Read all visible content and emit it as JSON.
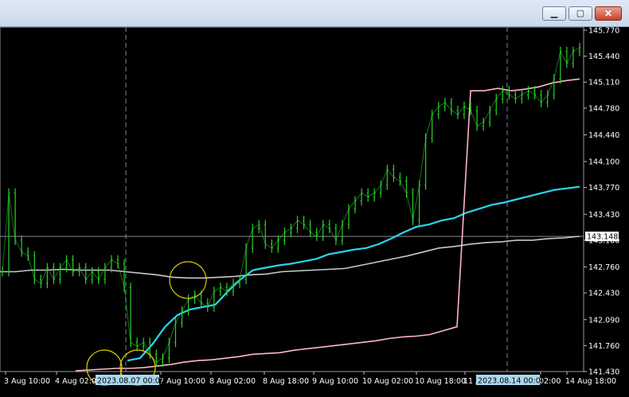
{
  "window": {
    "minimize_glyph": "▁",
    "maximize_glyph": "▢",
    "close_glyph": "✕"
  },
  "colors": {
    "background": "#000000",
    "candle": "#2bd12b",
    "ma_fast": "#2ad7f0",
    "ma_mid": "#c9c9c9",
    "ma_slow": "#ffb6c8",
    "price_line": "#8c8c8c",
    "crosshair": "#6c8fb0",
    "circle": "#d8cc00",
    "tag_bg": "#a9d8f0"
  },
  "chart_data": {
    "type": "line",
    "y_range": [
      141.43,
      145.77
    ],
    "y_ticks": [
      "145.770",
      "145.440",
      "145.110",
      "144.780",
      "144.440",
      "144.100",
      "143.770",
      "143.430",
      "143.100",
      "142.760",
      "142.430",
      "142.090",
      "141.760",
      "141.430"
    ],
    "current_price": "143.148",
    "x_labels": [
      "3 Aug 10:00",
      "4 Aug 02:00",
      "7 Aug 10:00",
      "8 Aug 02:00",
      "8 Aug 18:00",
      "9 Aug 10:00",
      "10 Aug 02:00",
      "10 Aug 18:00",
      "11 Aug",
      "02:00",
      "14 Aug 18:00"
    ],
    "crosshair_labels": [
      "2023.08.07 00:00",
      "2023.08.14 00:00"
    ],
    "price": [
      142.7,
      143.7,
      143.1,
      142.95,
      142.9,
      142.6,
      142.55,
      142.75,
      142.6,
      142.75,
      142.85,
      142.7,
      142.75,
      142.6,
      142.7,
      142.6,
      142.75,
      142.85,
      142.8,
      142.5,
      141.8,
      141.75,
      141.8,
      141.65,
      141.55,
      141.6,
      141.8,
      142.05,
      142.2,
      142.35,
      142.4,
      142.3,
      142.25,
      142.45,
      142.5,
      142.45,
      142.55,
      142.6,
      143.0,
      143.25,
      143.3,
      143.05,
      143.0,
      143.1,
      143.2,
      143.25,
      143.35,
      143.3,
      143.2,
      143.15,
      143.3,
      143.25,
      143.1,
      143.3,
      143.5,
      143.6,
      143.7,
      143.65,
      143.7,
      143.8,
      144.0,
      143.9,
      143.85,
      143.7,
      143.35,
      143.8,
      144.4,
      144.7,
      144.8,
      144.85,
      144.75,
      144.7,
      144.8,
      144.75,
      144.55,
      144.6,
      144.75,
      144.9,
      145.0,
      144.95,
      144.9,
      144.95,
      145.0,
      144.95,
      144.85,
      144.95,
      145.15,
      145.5,
      145.35,
      145.5,
      145.55
    ],
    "series": [
      {
        "values": [
          142.7,
          142.7,
          142.72,
          142.72,
          142.73,
          142.72,
          142.72,
          142.72,
          142.7,
          142.68,
          142.66,
          142.63,
          142.62,
          142.62,
          142.63,
          142.64,
          142.66,
          142.67,
          142.7,
          142.71,
          142.72,
          142.73,
          142.74,
          142.78,
          142.82,
          142.86,
          142.9,
          142.95,
          143.0,
          143.02,
          143.05,
          143.07,
          143.08,
          143.1,
          143.1,
          143.12,
          143.13,
          143.15
        ]
      },
      {
        "values": [
          141.57,
          141.6,
          141.78,
          142.0,
          142.15,
          142.22,
          142.25,
          142.28,
          142.45,
          142.6,
          142.72,
          142.75,
          142.78,
          142.8,
          142.83,
          142.86,
          142.92,
          142.95,
          142.98,
          143.0,
          143.05,
          143.12,
          143.2,
          143.27,
          143.3,
          143.35,
          143.38,
          143.45,
          143.5,
          143.55,
          143.58,
          143.62,
          143.66,
          143.7,
          143.74,
          143.76,
          143.78
        ]
      },
      {
        "values": [
          141.44,
          141.45,
          141.46,
          141.47,
          141.47,
          141.48,
          141.5,
          141.52,
          141.55,
          141.57,
          141.58,
          141.6,
          141.62,
          141.65,
          141.66,
          141.67,
          141.7,
          141.72,
          141.74,
          141.76,
          141.78,
          141.8,
          141.82,
          141.85,
          141.87,
          141.88,
          141.9,
          141.95,
          142.0,
          145.0,
          145.0,
          145.03,
          145.0,
          145.02,
          145.05,
          145.1,
          145.13,
          145.15
        ]
      }
    ]
  }
}
